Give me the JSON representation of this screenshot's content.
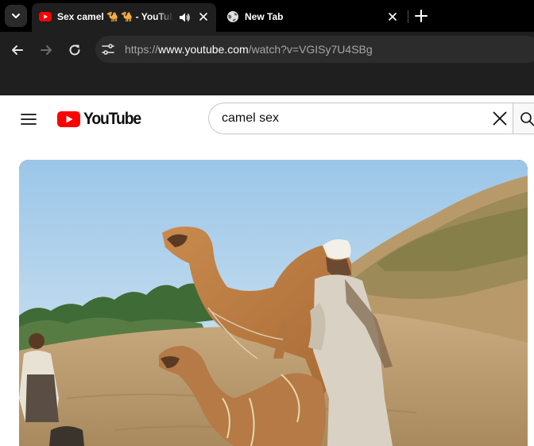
{
  "browser": {
    "tabs": [
      {
        "title": "Sex camel 🐪 🐪 - YouTube",
        "favicon": "youtube-favicon",
        "active": true,
        "playing_audio": true
      },
      {
        "title": "New Tab",
        "favicon": "globe-icon",
        "active": false
      }
    ],
    "address": {
      "scheme": "https://",
      "host": "www.youtube.com",
      "path": "/watch?v=VGISy7U4SBg"
    }
  },
  "youtube": {
    "logo_text": "YouTube",
    "search": {
      "query": "camel sex",
      "placeholder": "Search"
    },
    "player": {
      "scene": "Two camels in a sandy desert with a man in a white turban and another man on the left; green trees and dry grass in background",
      "accent": "#ff0000"
    }
  },
  "colors": {
    "chrome_dark": "#000000",
    "toolbar": "#1f1f1f",
    "youtube_red": "#ff0000"
  }
}
